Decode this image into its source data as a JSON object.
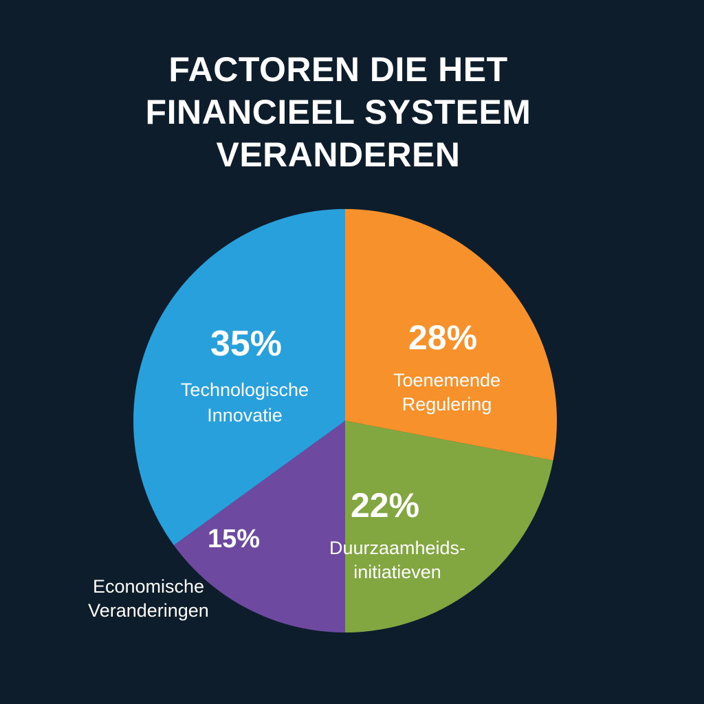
{
  "title_lines": [
    "FACTOREN DIE HET",
    "FINANCIEEL SYSTEEM",
    "VERANDEREN"
  ],
  "colors": {
    "background": "#0d1d2b",
    "text": "#ffffff"
  },
  "chart_data": {
    "type": "pie",
    "title": "FACTOREN DIE HET FINANCIEEL SYSTEEM VERANDEREN",
    "slices": [
      {
        "label": "Toenemende Regulering",
        "label_lines": [
          "Toenemende",
          "Regulering"
        ],
        "value": 28,
        "display": "28%",
        "color": "#f6912b"
      },
      {
        "label": "Duurzaamheidsinitiatieven",
        "label_lines": [
          "Duurzaamheids-",
          "initiatieven"
        ],
        "value": 22,
        "display": "22%",
        "color": "#83a740"
      },
      {
        "label": "Economische Veranderingen",
        "label_lines": [
          "Economische",
          "Veranderingen"
        ],
        "value": 15,
        "display": "15%",
        "color": "#6d4aa0"
      },
      {
        "label": "Technologische Innovatie",
        "label_lines": [
          "Technologische",
          "Innovatie"
        ],
        "value": 35,
        "display": "35%",
        "color": "#28a0dc"
      }
    ],
    "start_angle_deg": 0,
    "direction": "clockwise"
  }
}
